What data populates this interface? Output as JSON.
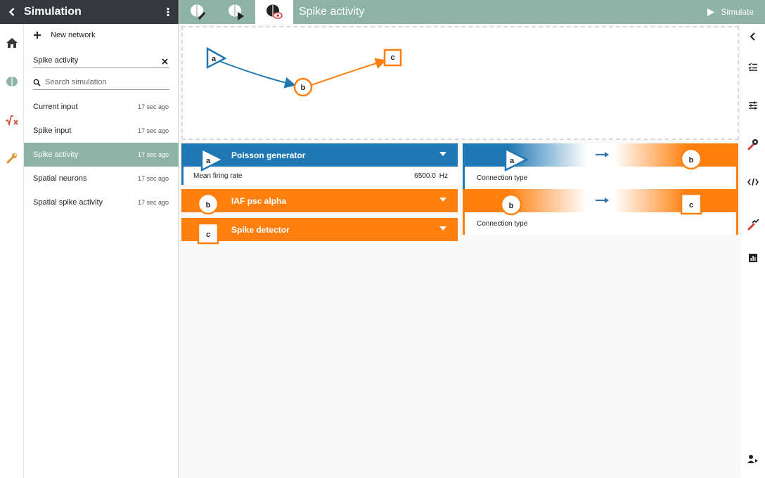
{
  "sidebar": {
    "title": "Simulation",
    "new_network_label": "New network",
    "filter_value": "Spike activity",
    "search_placeholder": "Search simulation",
    "items": [
      {
        "name": "Current input",
        "time": "17 sec ago"
      },
      {
        "name": "Spike input",
        "time": "17 sec ago"
      },
      {
        "name": "Spike activity",
        "time": "17 sec ago",
        "active": true
      },
      {
        "name": "Spatial neurons",
        "time": "17 sec ago"
      },
      {
        "name": "Spatial spike activity",
        "time": "17 sec ago"
      }
    ]
  },
  "topbar": {
    "view_title": "Spike activity",
    "simulate_label": "Simulate"
  },
  "graph": {
    "nodes": [
      {
        "label": "a",
        "shape": "triangle",
        "color": "#1f77b4"
      },
      {
        "label": "b",
        "shape": "circle",
        "color": "#ff7f0e"
      },
      {
        "label": "c",
        "shape": "square",
        "color": "#ff7f0e"
      }
    ],
    "edges": [
      {
        "from": "a",
        "to": "b"
      },
      {
        "from": "b",
        "to": "c"
      }
    ]
  },
  "nodes": [
    {
      "label": "a",
      "model": "Poisson generator",
      "color": "#1f77b4",
      "params": [
        {
          "name": "Mean firing rate",
          "value": "6500.0",
          "unit": "Hz"
        }
      ]
    },
    {
      "label": "b",
      "model": "IAF psc alpha",
      "color": "#ff7f0e"
    },
    {
      "label": "c",
      "model": "Spike detector",
      "color": "#ff7f0e"
    }
  ],
  "connections": [
    {
      "source": "a",
      "target": "b",
      "sub_label": "Connection type"
    },
    {
      "source": "b",
      "target": "c",
      "sub_label": "Connection type"
    }
  ],
  "colors": {
    "header_dark": "#35383c",
    "accent_green": "#8fb2a6",
    "blue": "#1f77b4",
    "orange": "#ff7f0e"
  }
}
